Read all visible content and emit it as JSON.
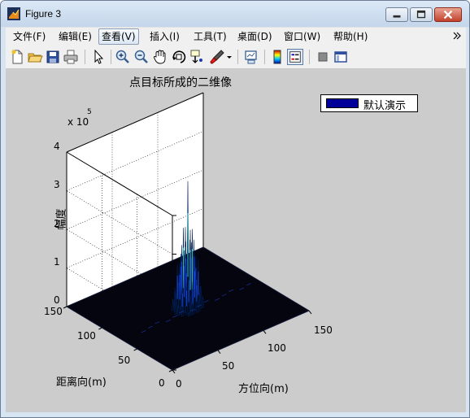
{
  "window": {
    "title": "Figure 3"
  },
  "menu": {
    "items": [
      "文件(F)",
      "编辑(E)",
      "查看(V)",
      "插入(I)",
      "工具(T)",
      "桌面(D)",
      "窗口(W)",
      "帮助(H)"
    ],
    "active": "查看(V)"
  },
  "toolbar": {
    "icons": [
      "new-figure-icon",
      "open-icon",
      "save-icon",
      "print-icon",
      "pointer-icon",
      "zoom-in-icon",
      "zoom-out-icon",
      "pan-icon",
      "rotate-3d-icon",
      "data-cursor-icon",
      "brush-icon",
      "link-plot-icon",
      "colorbar-icon",
      "legend-icon",
      "hide-plot-tools-icon",
      "show-plot-tools-icon"
    ]
  },
  "chart_data": {
    "type": "surface",
    "title": "点目标所成的二维像",
    "legend": [
      "默认演示"
    ],
    "xlabel": "方位向(m)",
    "ylabel": "距离向(m)",
    "zlabel": "幅度",
    "x_ticks": [
      "0",
      "50",
      "100",
      "150"
    ],
    "y_ticks": [
      "0",
      "50",
      "100",
      "150"
    ],
    "z_ticks": [
      "0",
      "1",
      "2",
      "3",
      "4"
    ],
    "z_exponent": "x 10",
    "z_exponent_power": "5",
    "xlim": [
      0,
      150
    ],
    "ylim": [
      0,
      150
    ],
    "zlim": [
      0,
      400000
    ],
    "peak": {
      "x": 75,
      "y": 75,
      "z": 330000
    },
    "grid": true,
    "legend_position": "top-right"
  }
}
